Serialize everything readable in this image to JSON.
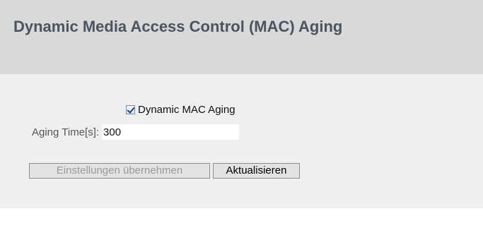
{
  "header": {
    "title": "Dynamic Media Access Control (MAC) Aging"
  },
  "form": {
    "dynamic_mac_aging": {
      "label": "Dynamic MAC Aging",
      "checked": true
    },
    "aging_time": {
      "label": "Aging Time[s]:",
      "value": "300"
    }
  },
  "buttons": {
    "apply_label": "Einstellungen übernehmen",
    "apply_disabled": true,
    "refresh_label": "Aktualisieren"
  },
  "colors": {
    "header_bg": "#d9d9d9",
    "content_bg": "#efefef",
    "title_color": "#4a5561"
  }
}
